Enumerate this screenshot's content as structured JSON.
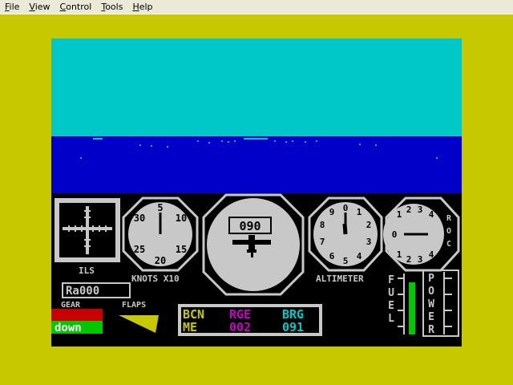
{
  "menu": [
    {
      "accel": "F",
      "rest": "ile"
    },
    {
      "accel": "V",
      "rest": "iew"
    },
    {
      "accel": "C",
      "rest": "ontrol"
    },
    {
      "accel": "T",
      "rest": "ools"
    },
    {
      "accel": "H",
      "rest": "elp"
    }
  ],
  "colors": {
    "sky": "#00c8c8",
    "sea": "#0000c8",
    "border": "#c8c800",
    "gauge": "#c8c8c8",
    "gear_red": "#c80000",
    "gear_green": "#00c800",
    "flaps": "#c8c800",
    "fuel_bar": "#00c800",
    "nav_yellow": "#c8c800",
    "nav_magenta": "#c800c8",
    "nav_blue": "#00c8c8"
  },
  "ils": {
    "label": "ILS"
  },
  "airspeed": {
    "label": "KNOTS X10",
    "numerals": [
      "5",
      "10",
      "15",
      "20",
      "25",
      "30"
    ]
  },
  "attitude": {
    "heading": "090"
  },
  "altimeter": {
    "label": "ALTIMETER",
    "numerals": [
      "0",
      "1",
      "2",
      "3",
      "4",
      "5",
      "6",
      "7",
      "8",
      "9"
    ]
  },
  "roc": {
    "label": "ROC",
    "numerals": [
      "1",
      "2",
      "3",
      "4",
      "0",
      "4",
      "3",
      "2",
      "1"
    ]
  },
  "radio": {
    "value": "Ra000"
  },
  "gear": {
    "label": "GEAR",
    "state": "down"
  },
  "flaps": {
    "label": "FLAPS"
  },
  "fuel": {
    "label": "FUEL",
    "level": 0.9
  },
  "power": {
    "label": "POWER"
  },
  "nav": {
    "col1_head": "BCN",
    "col2_head": "RGE",
    "col3_head": "BRG",
    "col1_val": "ME",
    "col2_val": "002",
    "col3_val": "091"
  }
}
